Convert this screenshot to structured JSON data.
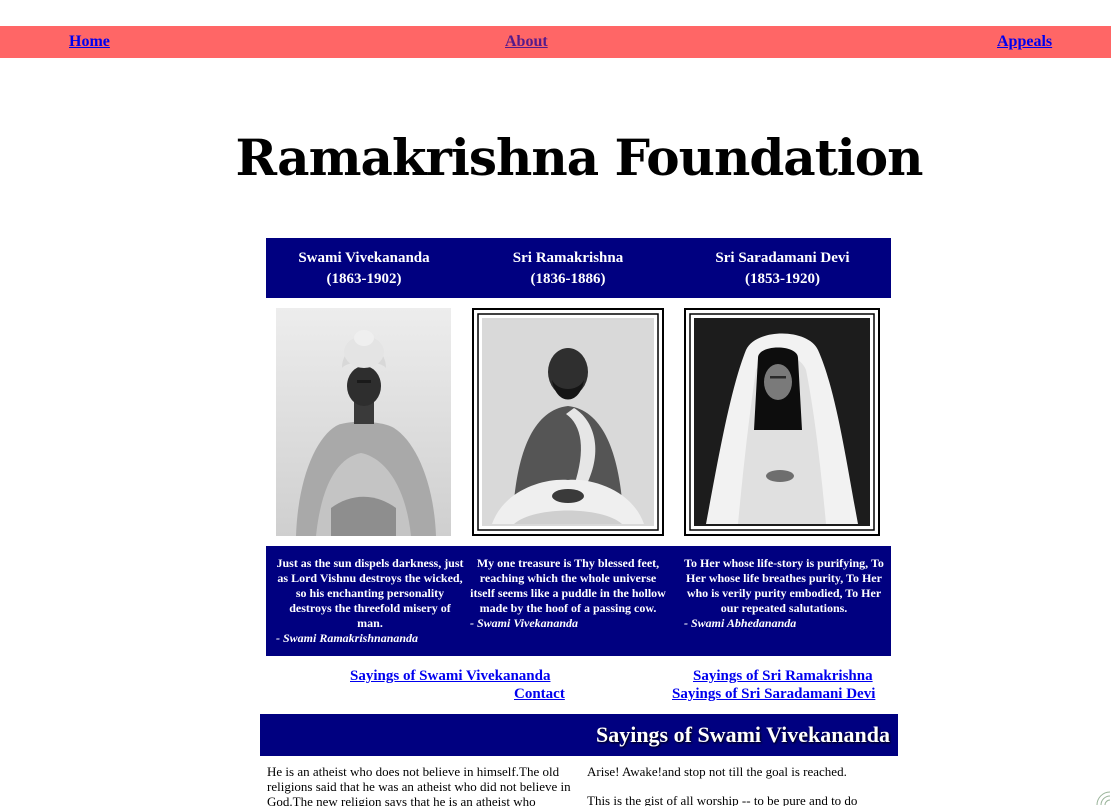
{
  "nav": {
    "home": "Home",
    "about": "About",
    "appeals": "Appeals"
  },
  "site_title": "Ramakrishna Foundation",
  "figures": [
    {
      "name": "Swami Vivekananda",
      "years": "(1863-1902)",
      "portrait_icon": "vivekananda-portrait"
    },
    {
      "name": "Sri Ramakrishna",
      "years": "(1836-1886)",
      "portrait_icon": "ramakrishna-portrait"
    },
    {
      "name": "Sri Saradamani Devi",
      "years": "(1853-1920)",
      "portrait_icon": "saradamani-devi-portrait"
    }
  ],
  "quotes": [
    {
      "text": "Just as the sun dispels darkness, just as Lord Vishnu destroys the wicked, so his enchanting personality destroys the threefold misery of man.",
      "attribution": "- Swami Ramakrishnananda"
    },
    {
      "text": "My one treasure is Thy blessed feet, reaching which the whole universe itself seems like a puddle in the hollow made by the hoof of a passing cow.",
      "attribution": "- Swami Vivekananda"
    },
    {
      "text": "To Her whose life-story is purifying, To Her whose life breathes purity, To Her who is verily purity embodied, To Her our repeated salutations.",
      "attribution": "- Swami  Abhedananda"
    }
  ],
  "links": {
    "sayings_vivekananda": "Sayings of Swami Vivekananda",
    "contact": "Contact",
    "sayings_ramakrishna": "Sayings of Sri Ramakrishna",
    "sayings_saradamani": "Sayings of Sri Saradamani Devi"
  },
  "sayings_section": {
    "heading": "Sayings of Swami Vivekananda",
    "paragraphs": [
      "He is an atheist who does not believe in himself.The old religions said that he was an atheist who did not believe in God.The new religion says that he is an atheist who",
      "Arise! Awake!and stop not till the goal is reached.",
      "This is the gist of all worship -- to be pure and to do"
    ]
  },
  "colors": {
    "nav_bar": "#ff6666",
    "band": "#000080",
    "link": "#0000ee",
    "visited_link": "#551a8b"
  }
}
